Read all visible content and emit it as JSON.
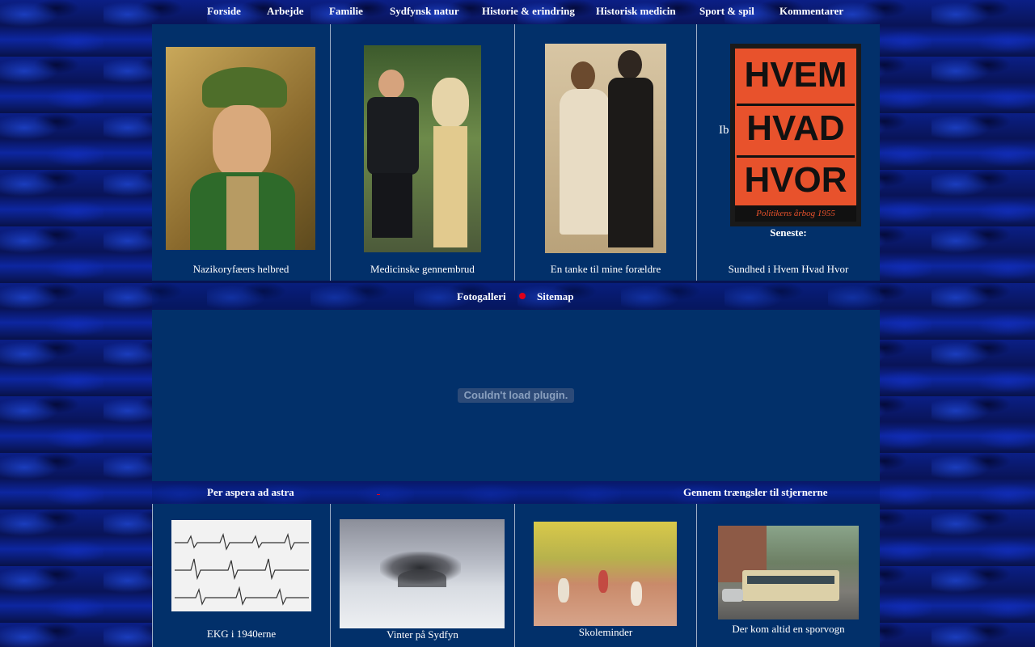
{
  "nav": [
    {
      "label": "Forside"
    },
    {
      "label": "Arbejde"
    },
    {
      "label": "Familie"
    },
    {
      "label": "Sydfynsk natur"
    },
    {
      "label": "Historie & erindring"
    },
    {
      "label": "Historisk medicin"
    },
    {
      "label": "Sport & spil"
    },
    {
      "label": "Kommentarer"
    }
  ],
  "top_cards": [
    {
      "caption": "Nazikoryfæers helbred"
    },
    {
      "caption": "Medicinske gennembrud"
    },
    {
      "caption": "En tanke til mine forældre"
    },
    {
      "caption": "Sundhed i Hvem Hvad Hvor"
    }
  ],
  "book": {
    "prefix": "Ib",
    "line1": "HVEM",
    "line2": "HVAD",
    "line3": "HVOR",
    "subtitle": "Politikens årbog 1955",
    "latest_label": "Seneste:"
  },
  "links_bar": {
    "gallery": "Fotogalleri",
    "sitemap": "Sitemap"
  },
  "plugin_message": "Couldn't load plugin.",
  "motto": {
    "left": "Per aspera ad astra",
    "right": "Gennem trængsler til stjernerne"
  },
  "bottom_cards": [
    {
      "caption": "EKG i 1940erne"
    },
    {
      "caption": "Vinter på Sydfyn"
    },
    {
      "caption": "Skoleminder"
    },
    {
      "caption": "Der kom altid en sporvogn"
    }
  ],
  "colors": {
    "panel": "#02306a",
    "accent_dot": "#e0001a",
    "text": "#ffffff"
  }
}
